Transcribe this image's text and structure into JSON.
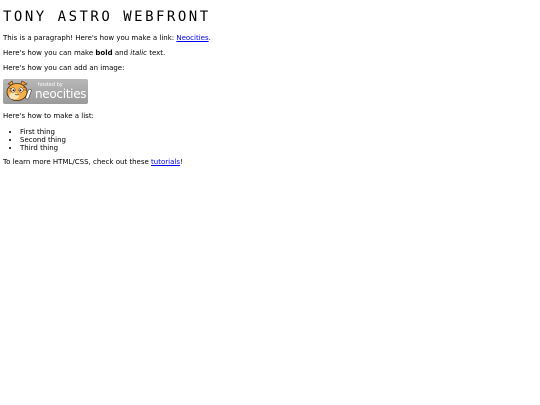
{
  "page": {
    "title": "TONY ASTRO WEBFRONT",
    "paragraph_link": {
      "before": "This is a paragraph! Here's how you make a link: ",
      "link_text": "Neocities",
      "after": "."
    },
    "formatting": {
      "before": "Here's how you can make ",
      "bold": "bold",
      "middle": " and ",
      "italic": "italic",
      "after": " text."
    },
    "image_intro": "Here's how you can add an image:",
    "badge": {
      "small_text": "hosted by",
      "big_text": "neocities",
      "icon": "neocities-cat-icon"
    },
    "list_intro": "Here's how to make a list:",
    "list_items": [
      "First thing",
      "Second thing",
      "Third thing"
    ],
    "learn_more": {
      "before": "To learn more HTML/CSS, check out these ",
      "link_text": "tutorials",
      "after": "!"
    }
  },
  "colors": {
    "link": "#0000ee",
    "text": "#000000",
    "background": "#ffffff",
    "badge": "#a8a8a8"
  }
}
